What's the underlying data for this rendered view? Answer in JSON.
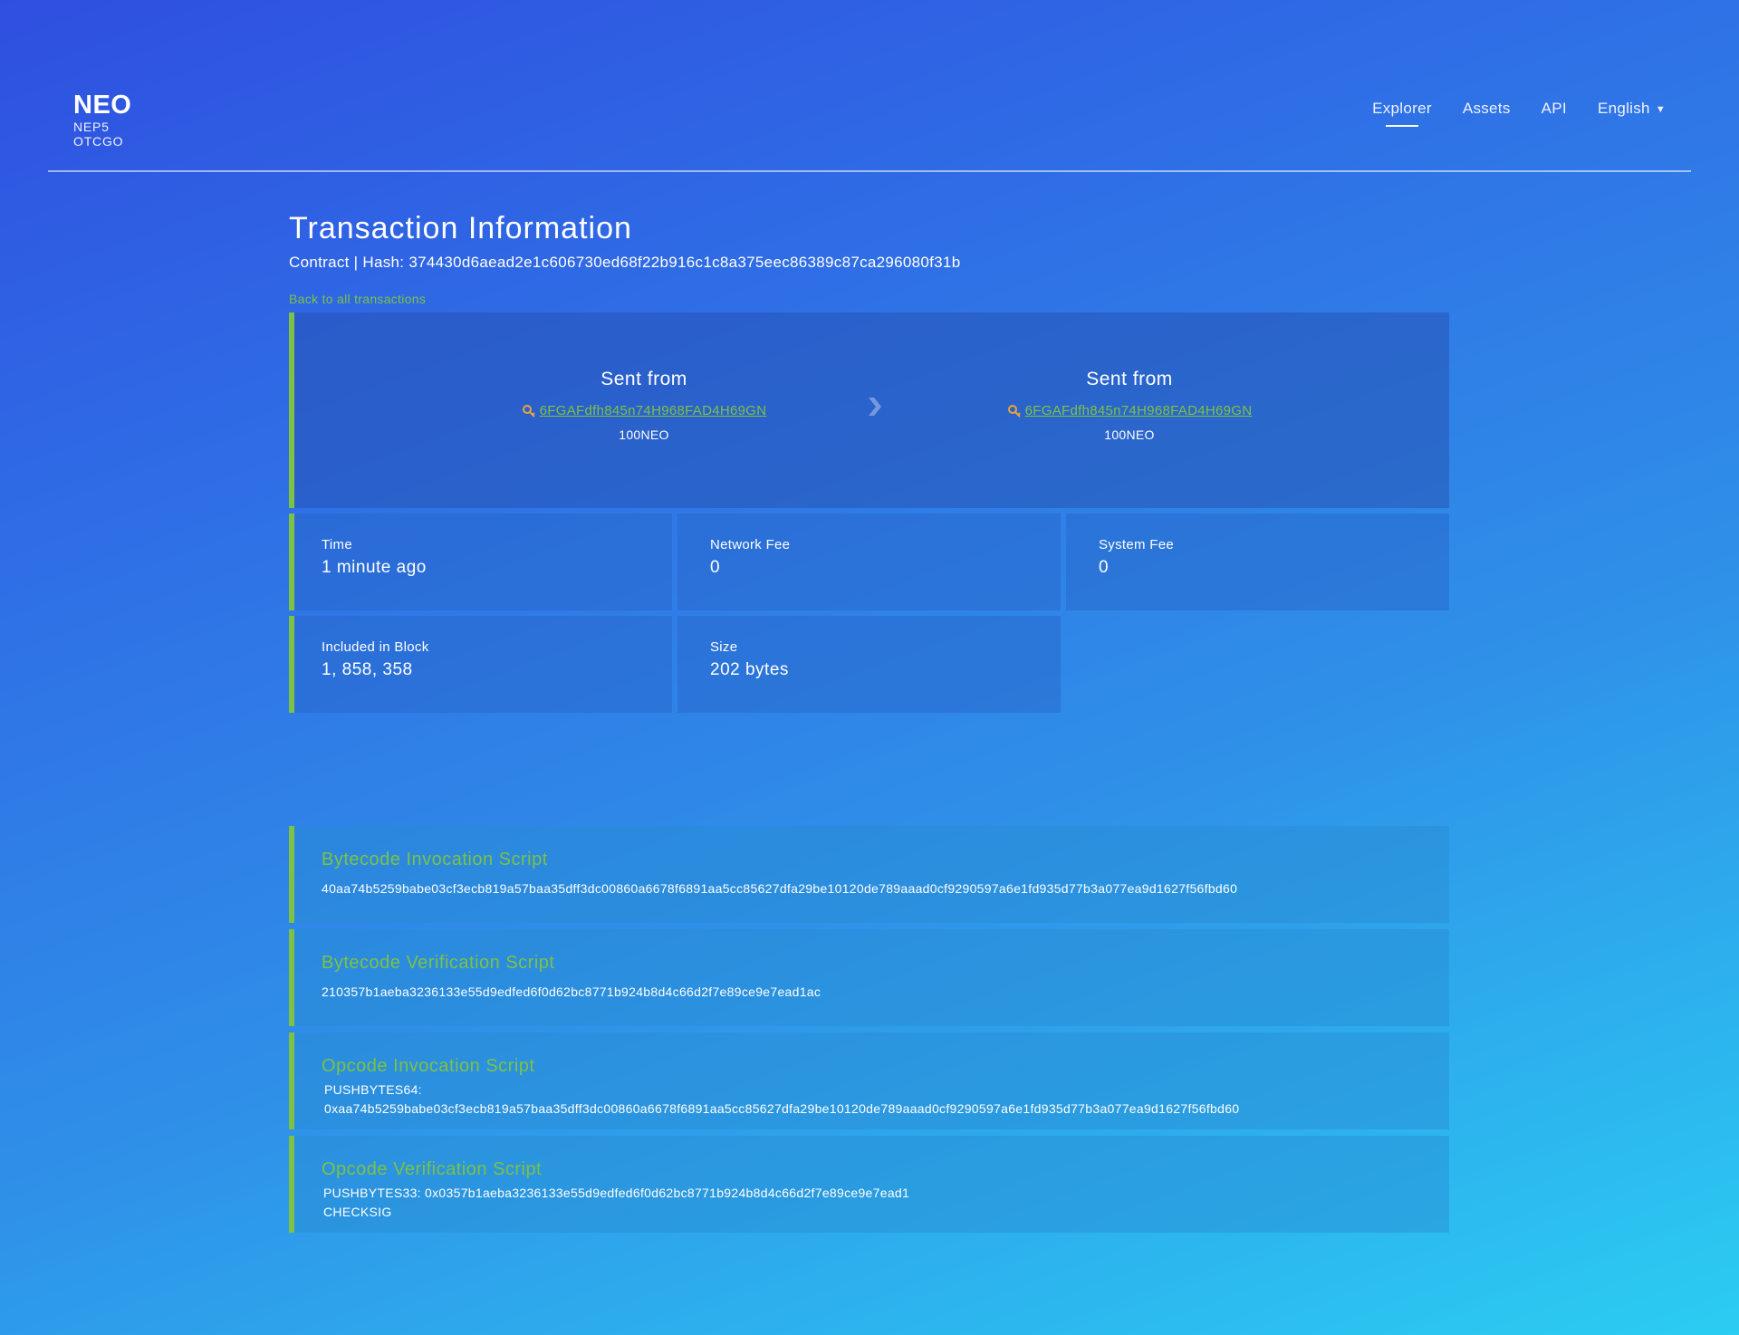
{
  "header": {
    "logo_name": "NEO",
    "logo_sub_1": "NEP5",
    "logo_sub_2": "OTCGO",
    "nav": [
      {
        "label": "Explorer",
        "active": true
      },
      {
        "label": "Assets"
      },
      {
        "label": "API"
      },
      {
        "label": "English"
      }
    ]
  },
  "page": {
    "title": "Transaction Information",
    "hash_line": "Contract | Hash: 374430d6aead2e1c606730ed68f22b916c1c8a375eec86389c87ca296080f31b",
    "back_link": "Back to all transactions"
  },
  "transfer": {
    "from": {
      "label": "Sent from",
      "address": "6FGAFdfh845n74H968FAD4H69GN",
      "amount": "100NEO"
    },
    "to": {
      "label": "Sent from",
      "address": "6FGAFdfh845n74H968FAD4H69GN",
      "amount": "100NEO"
    }
  },
  "stats": {
    "time": {
      "label": "Time",
      "value": "1 minute ago"
    },
    "network_fee": {
      "label": "Network Fee",
      "value": "0"
    },
    "system_fee": {
      "label": "System Fee",
      "value": "0"
    },
    "block": {
      "label": "Included in Block",
      "value": "1, 858, 358"
    },
    "size": {
      "label": "Size",
      "value": "202 bytes"
    }
  },
  "scripts": {
    "bytecode_invocation": {
      "title": "Bytecode Invocation Script",
      "body": "40aa74b5259babe03cf3ecb819a57baa35dff3dc00860a6678f6891aa5cc85627dfa29be10120de789aaad0cf9290597a6e1fd935d77b3a077ea9d1627f56fbd60"
    },
    "bytecode_verification": {
      "title": "Bytecode Verification Script",
      "body": "210357b1aeba3236133e55d9edfed6f0d62bc8771b924b8d4c66d2f7e89ce9e7ead1ac"
    },
    "opcode_invocation": {
      "title": "Opcode Invocation Script",
      "body_1": "PUSHBYTES64:",
      "body_2": "0xaa74b5259babe03cf3ecb819a57baa35dff3dc00860a6678f6891aa5cc85627dfa29be10120de789aaad0cf9290597a6e1fd935d77b3a077ea9d1627f56fbd60"
    },
    "opcode_verification": {
      "title": "Opcode Verification Script",
      "body_1": "PUSHBYTES33: 0x0357b1aeba3236133e55d9edfed6f0d62bc8771b924b8d4c66d2f7e89ce9e7ead1",
      "body_2": "CHECKSIG"
    }
  },
  "colors": {
    "accent_green": "#7dc244",
    "key_icon_orange": "#e8a43c"
  },
  "icons": {
    "key": "key-icon",
    "arrow": "chevron-right-icon",
    "caret": "caret-down-icon"
  }
}
